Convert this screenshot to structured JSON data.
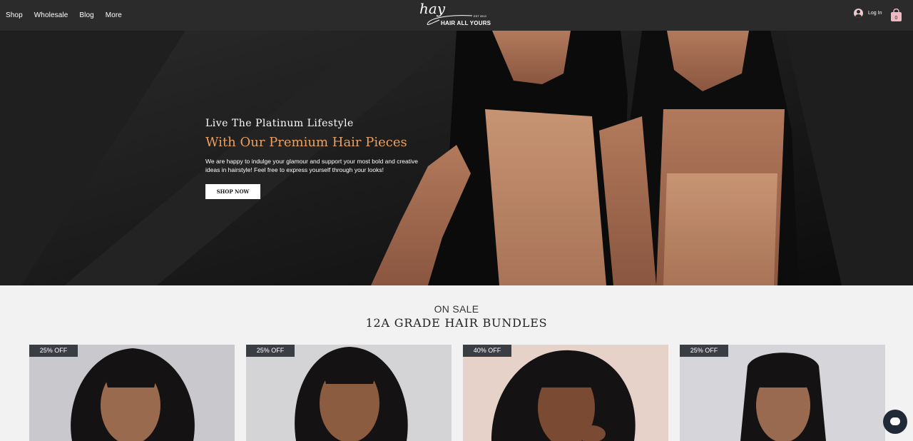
{
  "header": {
    "nav": [
      "Shop",
      "Wholesale",
      "Blog",
      "More"
    ],
    "logo_script": "hay",
    "logo_est": "EST 2013",
    "logo_brand": "HAIR ALL YOURS",
    "login_label": "Log In",
    "cart_count": "0"
  },
  "hero": {
    "kicker": "Live The Platinum Lifestyle",
    "title": "With Our Premium Hair Pieces",
    "text": "We are happy to indulge your glamour and support your most bold and creative ideas in hairstyle! Feel free to express yourself through your looks!",
    "button": "SHOP NOW"
  },
  "sale": {
    "subtitle": "ON SALE",
    "title": "12A GRADE HAIR BUNDLES",
    "products": [
      {
        "badge": "25% OFF"
      },
      {
        "badge": "25% OFF"
      },
      {
        "badge": "40% OFF"
      },
      {
        "badge": "25% OFF"
      }
    ]
  },
  "colors": {
    "header_bg": "#2b2b2b",
    "hero_accent": "#e8a063",
    "badge_bg": "#3b3d44",
    "chat_bg": "#1f2a36"
  },
  "icons": [
    "user-avatar-icon",
    "shopping-bag-icon",
    "chat-icon"
  ]
}
